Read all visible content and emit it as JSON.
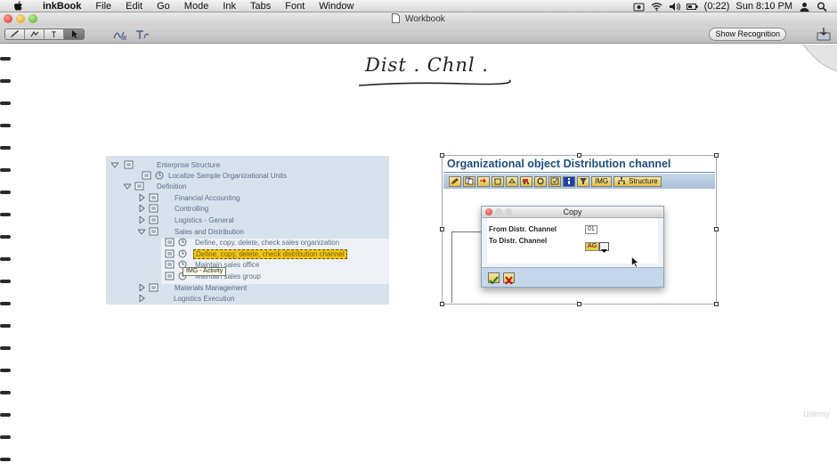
{
  "menubar": {
    "app_name": "inkBook",
    "items": [
      "File",
      "Edit",
      "Go",
      "Mode",
      "Ink",
      "Tabs",
      "Font",
      "Window"
    ],
    "battery_text": "(0:22)",
    "clock": "Sun 8:10 PM"
  },
  "window": {
    "title": "Workbook"
  },
  "toolbar": {
    "show_recognition_label": "Show Recognition",
    "tool_labels": [
      "T"
    ]
  },
  "page": {
    "handwritten_title": "Dist . Chnl .",
    "watermark": "Udemy"
  },
  "tree": {
    "rows": [
      {
        "label": "Enterprise Structure"
      },
      {
        "label": "Localize Sample Organizational Units"
      },
      {
        "label": "Definition"
      },
      {
        "label": "Financial Accounting"
      },
      {
        "label": "Controlling"
      },
      {
        "label": "Logistics - General"
      },
      {
        "label": "Sales and Distribution"
      },
      {
        "label": "Define, copy, delete, check sales organization"
      },
      {
        "label": "Define, copy, delete, check distribution channel"
      },
      {
        "label": "Maintain sales office"
      },
      {
        "label": "Maintain sales group"
      },
      {
        "label": "Materials Management"
      },
      {
        "label": "Logistics Execution"
      }
    ],
    "tooltip": "IMG - Activity"
  },
  "sap": {
    "title": "Organizational object Distribution channel",
    "toolbar_text_buttons": [
      "IMG",
      "Structure"
    ],
    "dialog": {
      "title": "Copy",
      "from_label": "From Distr. Channel",
      "from_value": "01",
      "to_label": "To Distr. Channel",
      "to_value": "AG"
    }
  },
  "colors": {
    "sap_title": "#1d4f80",
    "selection_highlight": "#f0c419",
    "tree_background": "#d8e2ec"
  },
  "icons": {
    "tree_node": "img-node-icon",
    "tree_activity": "clock-activity-icon",
    "dialog_ok": "checkmark-icon",
    "dialog_cancel": "cancel-x-icon"
  }
}
